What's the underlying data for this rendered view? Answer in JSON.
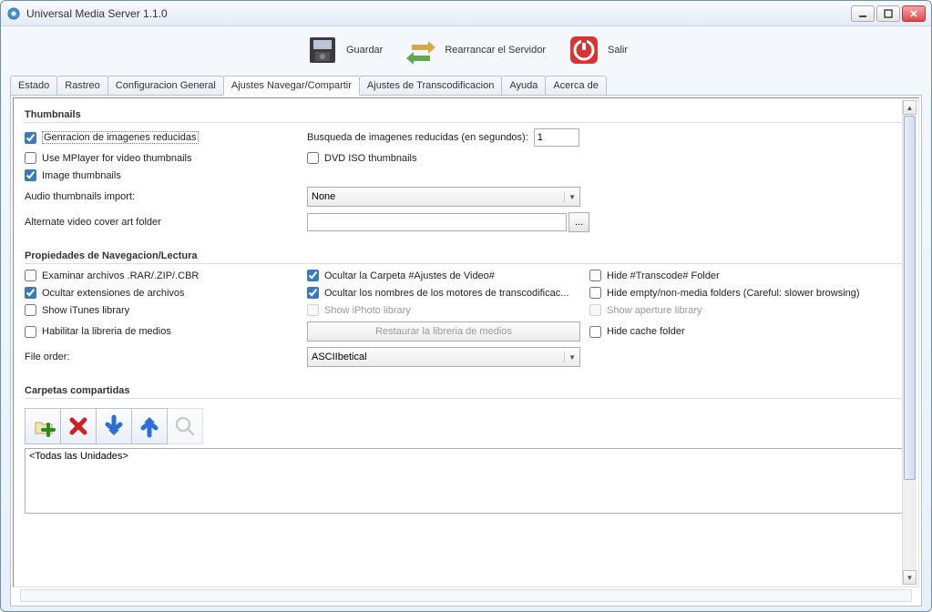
{
  "window": {
    "title": "Universal Media Server 1.1.0"
  },
  "toolbar": {
    "save": "Guardar",
    "restart": "Rearrancar el Servidor",
    "exit": "Salir"
  },
  "tabs": {
    "t0": "Estado",
    "t1": "Rastreo",
    "t2": "Configuracion General",
    "t3": "Ajustes Navegar/Compartir",
    "t4": "Ajustes de Transcodificacion",
    "t5": "Ayuda",
    "t6": "Acerca de"
  },
  "sections": {
    "thumbnails": "Thumbnails",
    "nav": "Propiedades de Navegacion/Lectura",
    "shared": "Carpetas compartidas"
  },
  "thumbnails": {
    "gen": "Genracion de imagenes reducidas",
    "search_label": "Busqueda de imagenes reducidas (en segundos):",
    "search_value": "1",
    "mplayer": "Use MPlayer for video thumbnails",
    "dvd": "DVD ISO thumbnails",
    "image": "Image thumbnails",
    "audio": "Audio thumbnails import:",
    "audio_value": "None",
    "alt": "Alternate video cover art folder",
    "alt_value": "",
    "browse": "..."
  },
  "nav": {
    "rar": "Examinar archivos .RAR/.ZIP/.CBR",
    "hide_video": "Ocultar la Carpeta #Ajustes de Video#",
    "hide_transcode": "Hide #Transcode# Folder",
    "hide_ext": "Ocultar extensiones de archivos",
    "hide_engines": "Ocultar los nombres de los motores de transcodificac...",
    "hide_empty": "Hide empty/non-media folders (Careful: slower browsing)",
    "itunes": "Show iTunes library",
    "iphoto": "Show iPhoto library",
    "aperture": "Show aperture library",
    "medialib": "Habilitar la libreria de medios",
    "restore": "Restaurar la libreria de medios",
    "hide_cache": "Hide cache folder",
    "file_order": "File order:",
    "file_order_value": "ASCIIbetical"
  },
  "shared": {
    "all_drives": "<Todas las Unidades>"
  }
}
